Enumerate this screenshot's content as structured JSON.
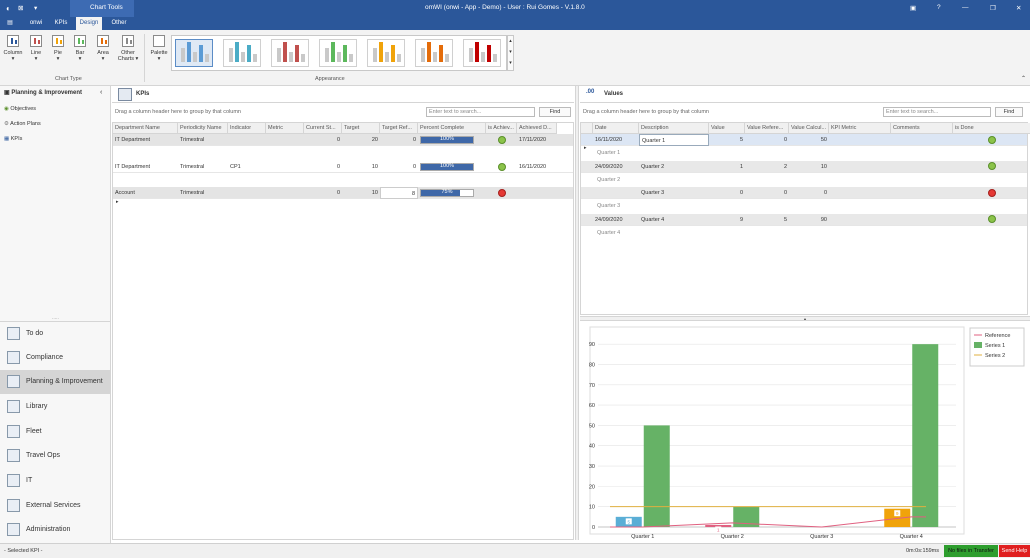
{
  "titlebar": {
    "chart_tools": "Chart Tools",
    "title": "omWI (onwi - App - Demo) - User : Rui Gomes - V.1.8.0"
  },
  "tabs": [
    {
      "label": "onwi"
    },
    {
      "label": "KPIs"
    },
    {
      "label": "Design"
    },
    {
      "label": "Other"
    }
  ],
  "ribbon": {
    "chart_type_buttons": [
      {
        "label": "Column"
      },
      {
        "label": "Line"
      },
      {
        "label": "Pie"
      },
      {
        "label": "Bar"
      },
      {
        "label": "Area"
      },
      {
        "label": "Other Charts"
      }
    ],
    "chart_type_group": "Chart Type",
    "palette_label": "Palette",
    "appearance_group": "Appearance",
    "palette_colors": [
      "#5b9bd5",
      "#4bacc6",
      "#c0504d",
      "#5cb85c",
      "#f0a30a",
      "#e46c0a",
      "#c00000"
    ]
  },
  "nav": {
    "header": "Planning & Improvement",
    "items": [
      {
        "label": "Objectives"
      },
      {
        "label": "Action Plans"
      },
      {
        "label": "KPIs"
      }
    ],
    "modules": [
      {
        "label": "To do"
      },
      {
        "label": "Compliance"
      },
      {
        "label": "Planning & Improvement"
      },
      {
        "label": "Library"
      },
      {
        "label": "Fleet"
      },
      {
        "label": "Travel Ops"
      },
      {
        "label": "IT"
      },
      {
        "label": "External Services"
      },
      {
        "label": "Administration"
      }
    ]
  },
  "kpis": {
    "title": "KPIs",
    "group_hint": "Drag a column header here to group by that column",
    "search_placeholder": "Enter text to search...",
    "find": "Find",
    "columns": [
      "Department Name",
      "Periodicity Name",
      "Indicator",
      "Metric",
      "Current St...",
      "Target",
      "Target Ref...",
      "Percent Complete",
      "is Achiev...",
      "Achieved D..."
    ],
    "rows": [
      {
        "dept": "IT Department",
        "period": "Trimestral",
        "indicator": "",
        "metric": "",
        "current": "0",
        "target": "20",
        "target_ref": "0",
        "pct": "100%",
        "pct_value": 1.0,
        "achieved": true,
        "date": "17/11/2020"
      },
      {
        "dept": "IT Department",
        "period": "Trimestral",
        "indicator": "CP1",
        "metric": "",
        "current": "0",
        "target": "10",
        "target_ref": "0",
        "pct": "100%",
        "pct_value": 1.0,
        "achieved": true,
        "date": "16/11/2020"
      },
      {
        "dept": "Account",
        "period": "Trimestral",
        "indicator": "",
        "metric": "",
        "current": "0",
        "target": "10",
        "target_ref": "8",
        "pct": "75%",
        "pct_value": 0.75,
        "achieved": false,
        "date": ""
      }
    ]
  },
  "values": {
    "title": "Values",
    "group_hint": "Drag a column header here to group by that column",
    "search_placeholder": "Enter text to search...",
    "find": "Find",
    "columns": [
      "Date",
      "Description",
      "Value",
      "Value Refere...",
      "Value Calcul...",
      "KPI Metric",
      "Comments",
      "is Done"
    ],
    "rows": [
      {
        "date": "16/11/2020",
        "desc": "Quarter 1",
        "value": "5",
        "ref": "0",
        "calc": "50",
        "done": true,
        "sub": "Quarter 1"
      },
      {
        "date": "24/09/2020",
        "desc": "Quarter 2",
        "value": "1",
        "ref": "2",
        "calc": "10",
        "done": true,
        "sub": "Quarter 2"
      },
      {
        "date": "",
        "desc": "Quarter 3",
        "value": "0",
        "ref": "0",
        "calc": "0",
        "done": false,
        "sub": "Quarter 3"
      },
      {
        "date": "24/09/2020",
        "desc": "Quarter 4",
        "value": "9",
        "ref": "5",
        "calc": "90",
        "done": true,
        "sub": "Quarter 4"
      }
    ]
  },
  "chart_data": {
    "type": "bar",
    "categories": [
      "Quarter 1",
      "Quarter 2",
      "Quarter 3",
      "Quarter 4"
    ],
    "series": [
      {
        "name": "Reference",
        "type": "line",
        "color": "#e06080",
        "values": [
          0,
          2,
          0,
          5
        ]
      },
      {
        "name": "Series 1",
        "type": "bar",
        "color": "#66b266",
        "values": [
          50,
          10,
          0,
          90
        ]
      },
      {
        "name": "Series 2",
        "type": "line",
        "color": "#e0b040",
        "values": [
          10,
          10,
          10,
          10
        ]
      }
    ],
    "value_bars": {
      "values": [
        5,
        1,
        0,
        9
      ],
      "colors": [
        "#5aaed6",
        "#e06080",
        "#5aaed6",
        "#f0a30a"
      ]
    },
    "yticks": [
      0,
      10,
      20,
      30,
      40,
      50,
      60,
      70,
      80,
      90
    ],
    "ylim": [
      0,
      95
    ],
    "legend": "top-right"
  },
  "status": {
    "left": "- Selected KPI -",
    "time": "0m:0s:159ms",
    "transfer": "No files in Transfer",
    "help": "Send Help"
  }
}
